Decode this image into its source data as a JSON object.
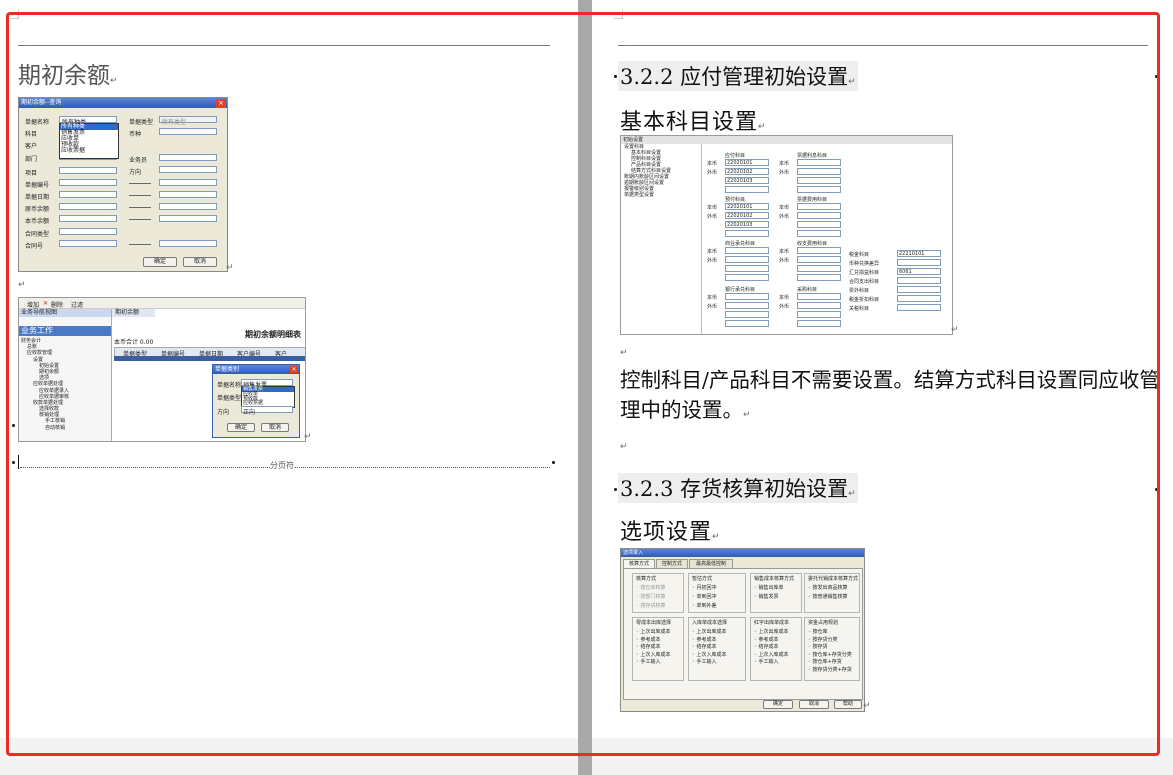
{
  "left_page": {
    "heading": "期初余额",
    "para_mark": "↵",
    "page_break_label": "分页符",
    "dialog": {
      "title": "期初余额--查询",
      "close": "×",
      "labels": [
        "单据名称",
        "科目",
        "客户",
        "部门",
        "项目",
        "单据编号",
        "单据日期",
        "原币余额",
        "本币余额",
        "合同类型",
        "合同号"
      ],
      "right_labels": [
        "单据类型",
        "币种",
        "业务员",
        "方向"
      ],
      "doc_name_value": "所有种类",
      "doc_type_value": "所有类型",
      "dropdown_items": [
        "所有种类",
        "销售发票",
        "应收单",
        "预收款",
        "应收票据"
      ],
      "ok": "确定",
      "cancel": "取消"
    },
    "second_shot": {
      "toolbar": [
        "增加",
        "删除",
        "过滤"
      ],
      "nav_title": "业务导航视图",
      "nav_section": "业务工作",
      "nav_items": [
        "财务会计",
        "总账",
        "应收款管理",
        "设置",
        "初始设置",
        "期初余额",
        "选项",
        "应收单据处理",
        "应收单据录入",
        "应收单据审核",
        "收款单据处理",
        "选择收款",
        "核销处理",
        "手工核销",
        "自动核销"
      ],
      "tab": "期初余额",
      "report_title": "期初余额明细表",
      "total": "本币合计 0.00",
      "columns": [
        "单据类型",
        "单据编号",
        "单据日期",
        "客户编号",
        "客户"
      ],
      "popup_title": "单据类别",
      "popup_labels": [
        "单据名称",
        "单据类型",
        "方向"
      ],
      "popup_name_value": "销售发票",
      "popup_items": [
        "销售发票",
        "应收单",
        "预收款",
        "应收票据"
      ],
      "popup_dir_value": "正向",
      "ok": "确定",
      "cancel": "取消"
    }
  },
  "right_page": {
    "section_1": "3.2.2 应付管理初始设置",
    "sub_1": "基本科目设置",
    "paragraph": "控制科目/产品科目不需要设置。结算方式科目设置同应收管理中的设置。",
    "section_2": "3.2.3 存货核算初始设置",
    "sub_2": "选项设置",
    "acct_shot": {
      "title": "初始设置",
      "tree": [
        "设置科目",
        "基本科目设置",
        "控制科目设置",
        "产品科目设置",
        "结算方式科目设置",
        "账期内账龄区间设置",
        "逾期账龄区间设置",
        "报警级别设置",
        "单据类型设置"
      ],
      "groups": [
        "应付科目",
        "票据利息科目",
        "预付科目",
        "票据费用科目",
        "商业承兑科目",
        "收支费用科目",
        "银行承兑科目",
        "采购科目"
      ],
      "codes": [
        "22020101",
        "22020102",
        "22020103"
      ],
      "bz": "本币",
      "wb": "外币",
      "right_labels": [
        "税金科目",
        "币种兑换差异",
        "汇兑损益科目",
        "合同支出科目",
        "票外科目",
        "税金折扣科目",
        "关税科目"
      ],
      "right_values": [
        "22210101",
        "",
        "6061",
        "",
        "",
        "",
        ""
      ]
    },
    "opt_shot": {
      "title": "选项录入",
      "tabs": [
        "核算方式",
        "控制方式",
        "最高最低控制"
      ],
      "boxes": [
        {
          "title": "核算方式",
          "items": [
            "按仓库核算",
            "按部门核算",
            "按存货核算"
          ]
        },
        {
          "title": "暂估方式",
          "items": [
            "月初回冲",
            "单到回冲",
            "单到补差"
          ]
        },
        {
          "title": "销售成本核算方式",
          "items": [
            "销售出库单",
            "销售发票"
          ]
        },
        {
          "title": "委托代销成本核算方式",
          "items": [
            "按发出商品核算",
            "按普通销售核算"
          ]
        },
        {
          "title": "零成本出库选择",
          "items": [
            "上次出库成本",
            "参考成本",
            "结存成本",
            "上次入库成本",
            "手工输入"
          ]
        },
        {
          "title": "入库单成本选择",
          "items": [
            "上次出库成本",
            "参考成本",
            "结存成本",
            "上次入库成本",
            "手工输入"
          ]
        },
        {
          "title": "红字出库单成本",
          "items": [
            "上次出库成本",
            "参考成本",
            "结存成本",
            "上次入库成本",
            "手工输入"
          ]
        },
        {
          "title": "资金占用规划",
          "items": [
            "按仓库",
            "按存货分类",
            "按存货",
            "按仓库+存货分类",
            "按仓库+存货",
            "按存货分类+存货"
          ]
        }
      ],
      "ok": "确定",
      "cancel": "取消",
      "help": "帮助"
    }
  }
}
